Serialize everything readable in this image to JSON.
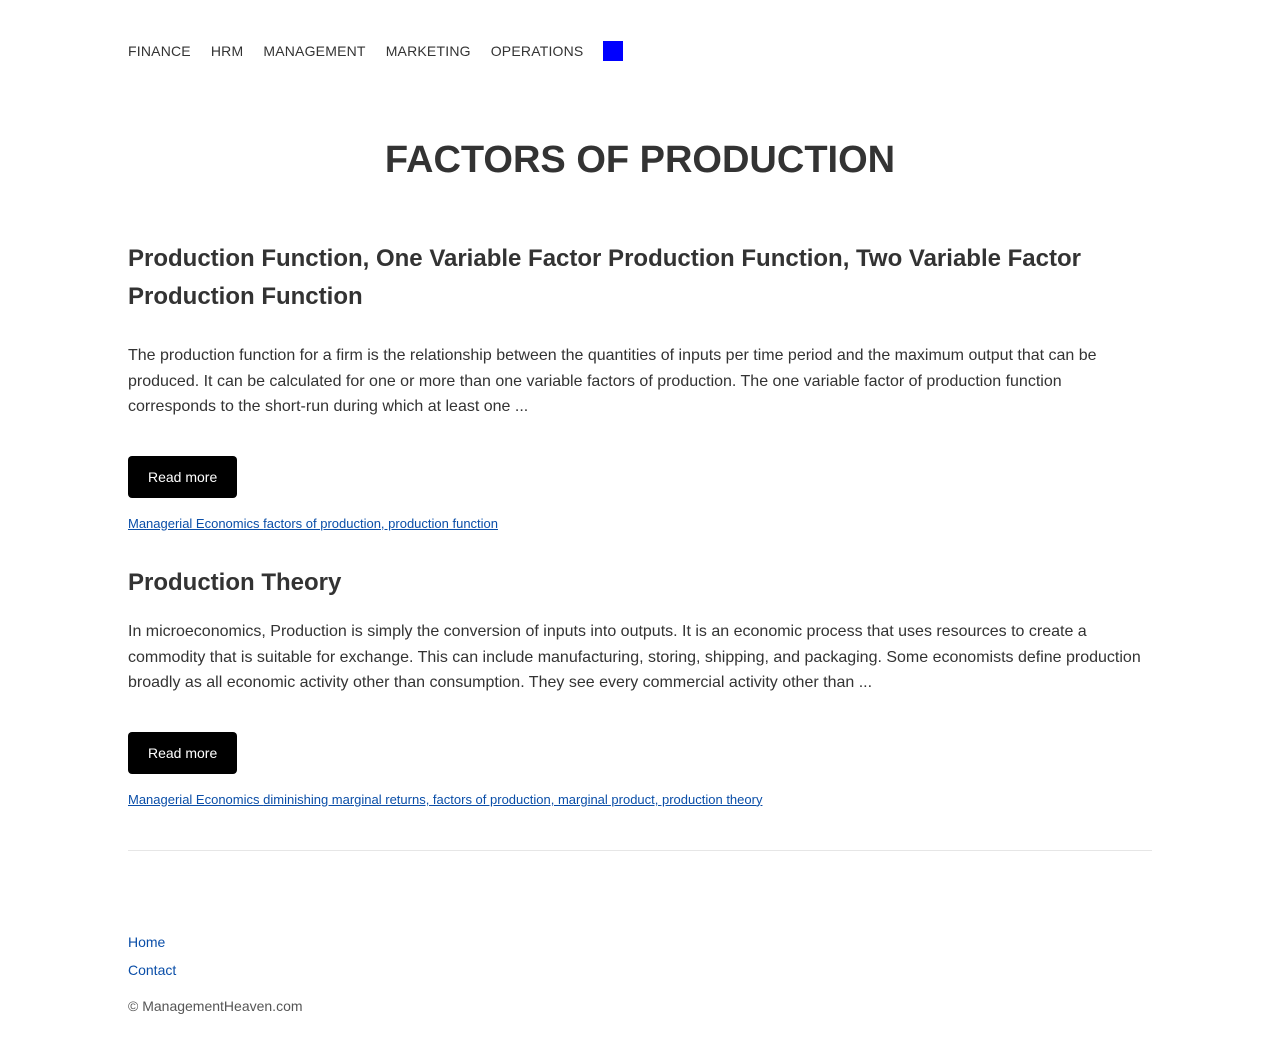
{
  "nav": {
    "items": [
      "FINANCE",
      "HRM",
      "MANAGEMENT",
      "MARKETING",
      "OPERATIONS"
    ],
    "square_color": "#0000ff"
  },
  "page_title": "FACTORS OF PRODUCTION",
  "posts": [
    {
      "title": "Production Function, One Variable Factor Production Function, Two Variable Factor Production Function",
      "excerpt": "The production function for a firm is the relationship between the quantities of inputs per time period and the maximum output that can be produced. It can be calculated for one or more than one variable factors of production. The one variable factor of production function corresponds to the short-run during which at least one ...",
      "button_label": "Read more",
      "category": "Managerial Economics",
      "tags": "factors of production, production function"
    },
    {
      "title": "Production Theory",
      "excerpt": "In microeconomics, Production is simply the conversion of inputs into outputs. It is an economic process that uses resources to create a commodity that is suitable for exchange. This can include manufacturing, storing, shipping, and packaging. Some economists define production broadly as all economic activity other than consumption. They see every commercial activity other than ...",
      "button_label": "Read more",
      "category": "Managerial Economics",
      "tags": "diminishing marginal returns, factors of production, marginal product, production theory"
    }
  ],
  "footer": {
    "links": [
      "Home",
      "Contact"
    ],
    "copyright": "© ManagementHeaven.com"
  },
  "colors": {
    "link": "#0a4ea8",
    "button_bg": "#000000",
    "text": "#333333"
  }
}
